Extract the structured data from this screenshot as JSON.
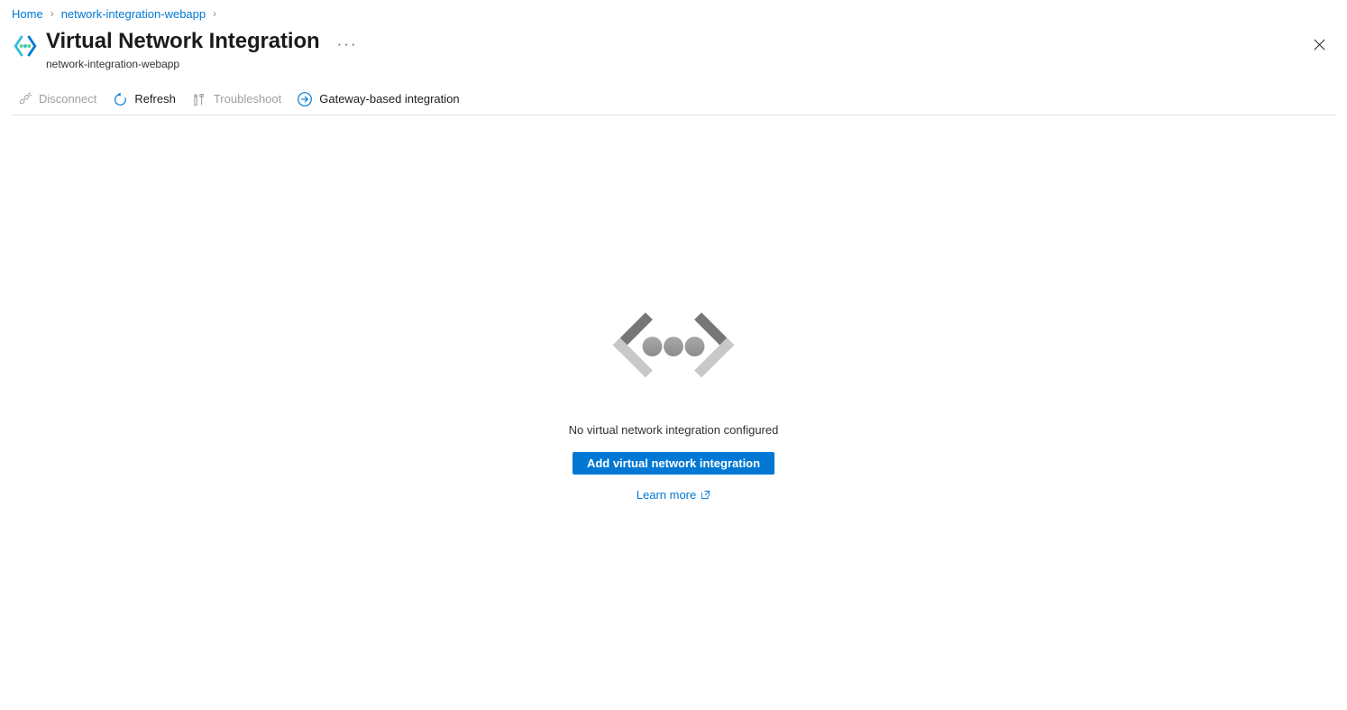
{
  "breadcrumb": {
    "items": [
      {
        "label": "Home"
      },
      {
        "label": "network-integration-webapp"
      }
    ],
    "separator": "›"
  },
  "header": {
    "title": "Virtual Network Integration",
    "subtitle": "network-integration-webapp",
    "more_label": "···",
    "icon": "vnet-integration-icon",
    "close_icon": "close-icon"
  },
  "toolbar": {
    "commands": [
      {
        "label": "Disconnect",
        "icon": "disconnect-icon",
        "enabled": false
      },
      {
        "label": "Refresh",
        "icon": "refresh-icon",
        "enabled": true
      },
      {
        "label": "Troubleshoot",
        "icon": "troubleshoot-icon",
        "enabled": false
      },
      {
        "label": "Gateway-based integration",
        "icon": "arrow-circle-right-icon",
        "enabled": true
      }
    ]
  },
  "empty_state": {
    "illustration": "code-brackets-dots-illustration",
    "message": "No virtual network integration configured",
    "primary_button": "Add virtual network integration",
    "learn_more": "Learn more",
    "learn_more_icon": "external-link-icon"
  },
  "colors": {
    "accent": "#0078d4",
    "link": "#0078d4",
    "text_primary": "#1b1b1b",
    "text_secondary": "#323130",
    "text_disabled": "#a19f9d",
    "divider": "#e1dfdd",
    "art_dark": "#767676",
    "art_light": "#c8c8c8",
    "art_dot": "#9e9e9e"
  }
}
